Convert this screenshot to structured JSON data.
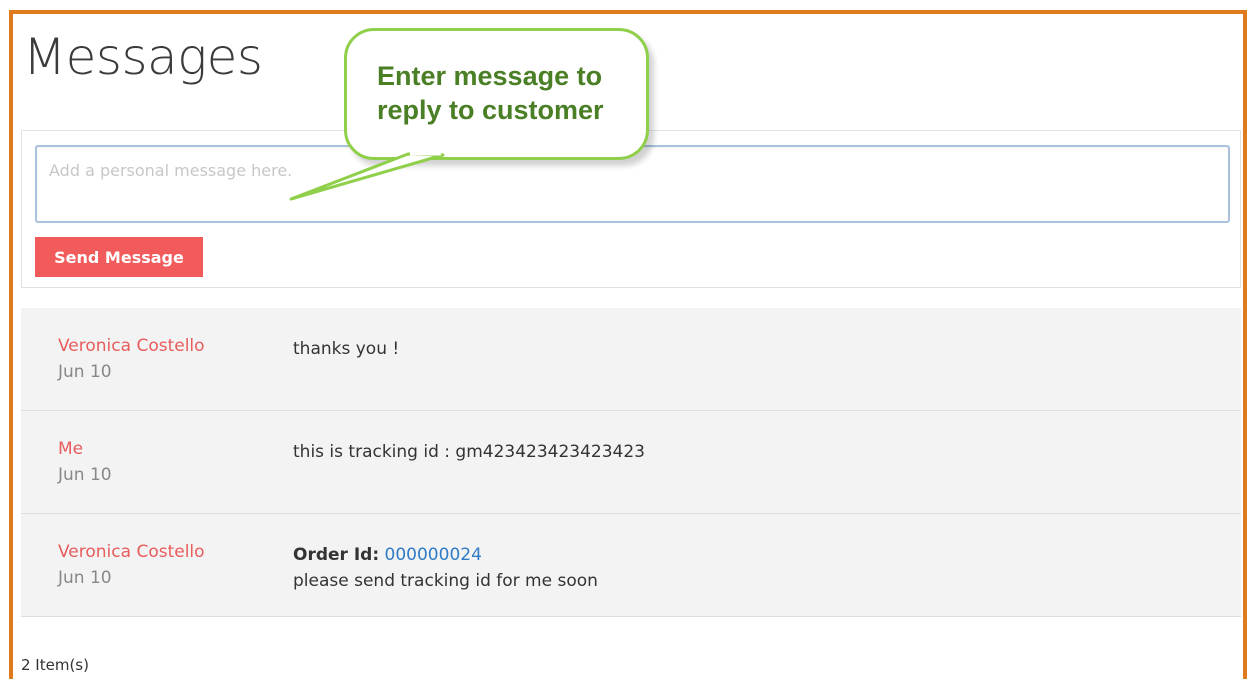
{
  "page": {
    "title": "Messages"
  },
  "compose": {
    "placeholder": "Add a personal message here.",
    "value": "",
    "send_label": "Send Message"
  },
  "messages": [
    {
      "sender": "Veronica Costello",
      "date": "Jun 10",
      "text": "thanks you !"
    },
    {
      "sender": "Me",
      "date": "Jun 10",
      "text": "this is tracking id : gm423423423423423"
    },
    {
      "sender": "Veronica Costello",
      "date": "Jun 10",
      "order_label": "Order Id:",
      "order_id": "000000024",
      "text": "please send tracking id for me soon"
    }
  ],
  "footer": {
    "item_count": "2 Item(s)"
  },
  "annotation": {
    "line1": "Enter message to",
    "line2": "reply to customer"
  },
  "colors": {
    "frame": "#e07a1f",
    "accent": "#f25b5b",
    "sender": "#e85c5c",
    "link": "#2f7bc6",
    "callout_border": "#8fcf4a",
    "callout_text": "#4b7f26"
  }
}
